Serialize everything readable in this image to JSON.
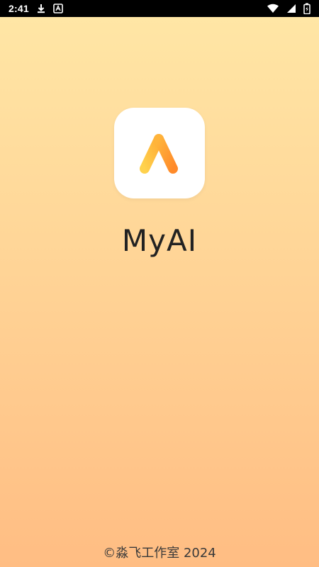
{
  "status_bar": {
    "time": "2:41",
    "left_icons": [
      "download-icon",
      "font-badge-icon"
    ],
    "right_icons": [
      "wifi-icon",
      "cellular-signal-icon",
      "battery-icon"
    ]
  },
  "splash": {
    "app_icon": "app-logo-a-icon",
    "app_name": "MyAI",
    "copyright": "©淼飞工作室 2024"
  },
  "colors": {
    "background_top": "#ffe7a6",
    "background_bottom": "#ffbd83",
    "logo_gradient_start": "#ffd24d",
    "logo_gradient_end": "#ff8a2a"
  }
}
